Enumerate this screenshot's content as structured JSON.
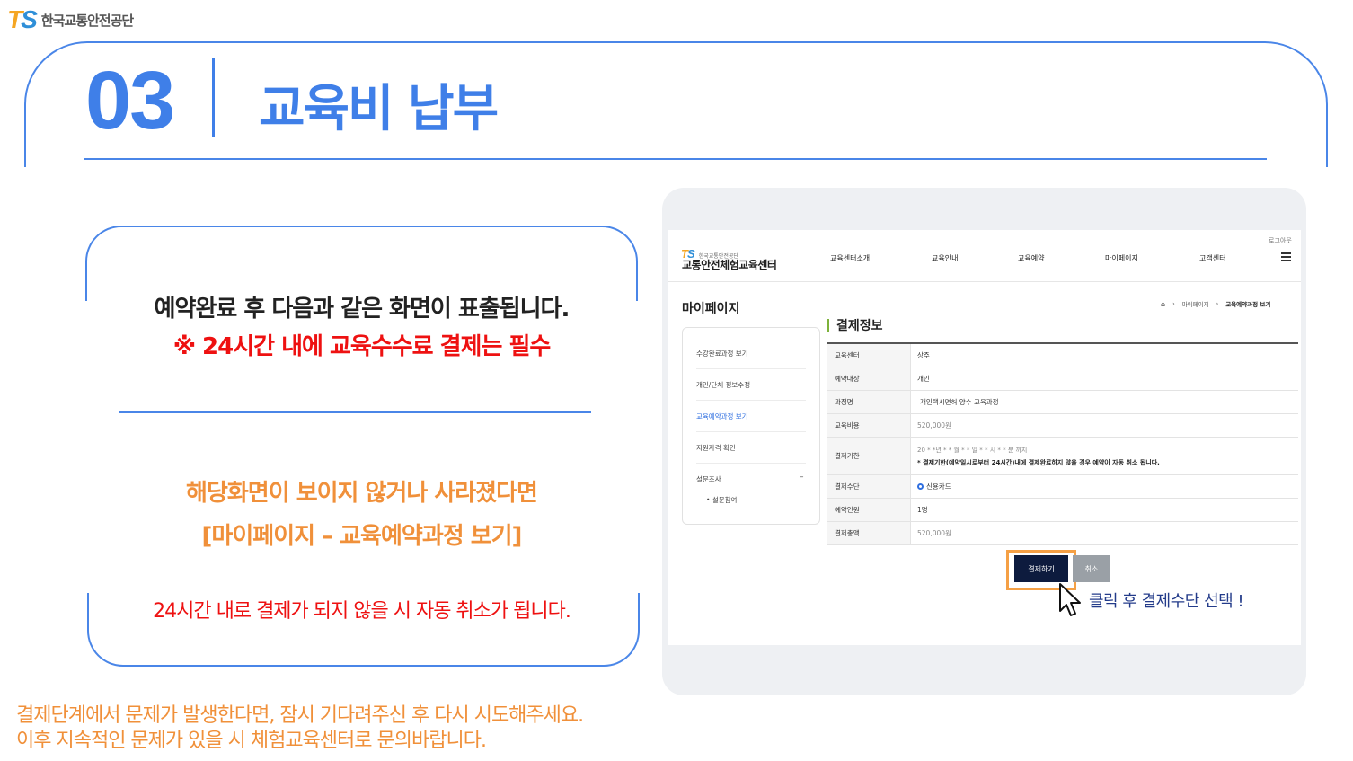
{
  "brand": {
    "ts_t": "T",
    "ts_s": "S",
    "org": "한국교통안전공단"
  },
  "section": {
    "number": "03",
    "title": "교육비 납부"
  },
  "card": {
    "notice_1": "예약완료 후 다음과 같은 화면이 표출됩니다.",
    "notice_2": "※ 24시간 내에 교육수수료 결제는 필수",
    "hint_1": "해당화면이 보이지 않거나 사라졌다면",
    "hint_2": "[마이페이지 – 교육예약과정 보기]",
    "warning": "24시간 내로 결제가 되지 않을 시 자동 취소가 됩니다."
  },
  "footer": {
    "line_1": "결제단계에서 문제가 발생한다면, 잠시 기다려주신 후 다시 시도해주세요.",
    "line_2": "이후 지속적인 문제가 있을 시 체험교육센터로 문의바랍니다."
  },
  "screenshot": {
    "logout": "로그아웃",
    "logo_small": "한국교통안전공단",
    "site_name": "교통안전체험교육센터",
    "nav": [
      "교육센터소개",
      "교육안내",
      "교육예약",
      "마이페이지",
      "고객센터"
    ],
    "page_title": "마이페이지",
    "breadcrumb": [
      "마이페이지",
      "교육예약과정 보기"
    ],
    "sidebar": {
      "item_1": "수강완료과정 보기",
      "item_2": "개인/단체 정보수정",
      "item_3": "교육예약과정 보기",
      "item_4": "지원자격 확인",
      "item_5": "설문조사",
      "item_5_toggle": "–",
      "sub_1": "설문참여"
    },
    "heading": "결제정보",
    "table": {
      "center_label": "교육센터",
      "center_value": "상주",
      "target_label": "예약대상",
      "target_value": "개인",
      "course_label": "과정명",
      "course_value": "개인택시면허 양수 교육과정",
      "fee_label": "교육비용",
      "fee_value": "520,000원",
      "deadline_label": "결제기한",
      "deadline_value": "20 * *년 * * 월 * * 일 * * 시 * * 분 까지",
      "deadline_note": "* 결제기한(예약일시로부터 24시간)내에 결제완료하지 않을 경우 예약이 자동 취소 됩니다.",
      "method_label": "결제수단",
      "method_value": "신용카드",
      "people_label": "예약인원",
      "people_value": "1명",
      "total_label": "결제총액",
      "total_value": "520,000원"
    },
    "pay_button": "결제하기",
    "cancel_button": "취소",
    "callout": "클릭 후 결제수단 선택 !"
  }
}
